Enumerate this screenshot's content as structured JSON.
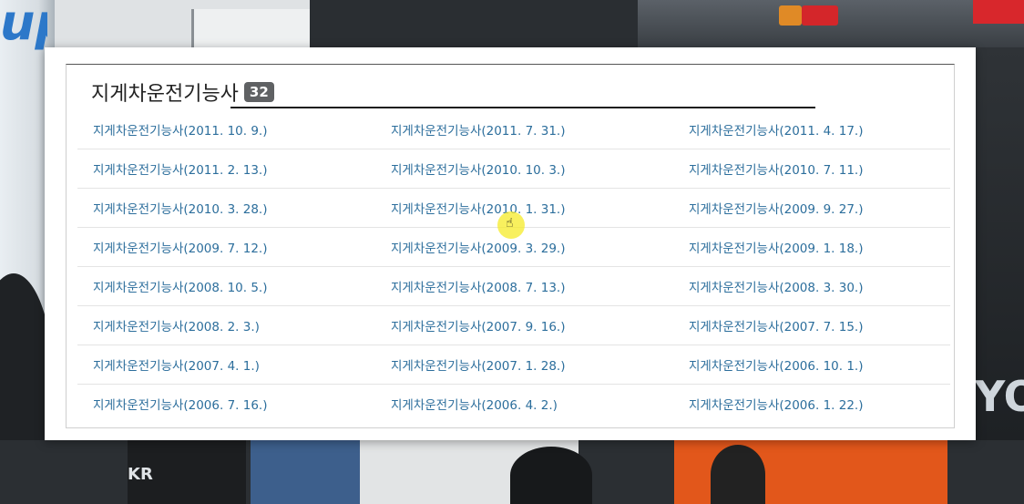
{
  "section": {
    "title": "지게차운전기능사",
    "count": "32"
  },
  "links": [
    [
      "지게차운전기능사(2011. 10. 9.)",
      "지게차운전기능사(2011. 7. 31.)",
      "지게차운전기능사(2011. 4. 17.)"
    ],
    [
      "지게차운전기능사(2011. 2. 13.)",
      "지게차운전기능사(2010. 10. 3.)",
      "지게차운전기능사(2010. 7. 11.)"
    ],
    [
      "지게차운전기능사(2010. 3. 28.)",
      "지게차운전기능사(2010. 1. 31.)",
      "지게차운전기능사(2009. 9. 27.)"
    ],
    [
      "지게차운전기능사(2009. 7. 12.)",
      "지게차운전기능사(2009. 3. 29.)",
      "지게차운전기능사(2009. 1. 18.)"
    ],
    [
      "지게차운전기능사(2008. 10. 5.)",
      "지게차운전기능사(2008. 7. 13.)",
      "지게차운전기능사(2008. 3. 30.)"
    ],
    [
      "지게차운전기능사(2008. 2. 3.)",
      "지게차운전기능사(2007. 9. 16.)",
      "지게차운전기능사(2007. 7. 15.)"
    ],
    [
      "지게차운전기능사(2007. 4. 1.)",
      "지게차운전기능사(2007. 1. 28.)",
      "지게차운전기능사(2006. 10. 1.)"
    ],
    [
      "지게차운전기능사(2006. 7. 16.)",
      "지게차운전기능사(2006. 4. 2.)",
      "지게차운전기능사(2006. 1. 22.)"
    ]
  ],
  "background": {
    "logo_text": "upe",
    "brand_text": "KR",
    "right_letters": "YO"
  },
  "colors": {
    "link": "#2c6e9c",
    "badge": "#5f6163",
    "cursor_highlight": "#f5eb28"
  },
  "icons": {
    "cursor": "hand-pointer-icon"
  }
}
